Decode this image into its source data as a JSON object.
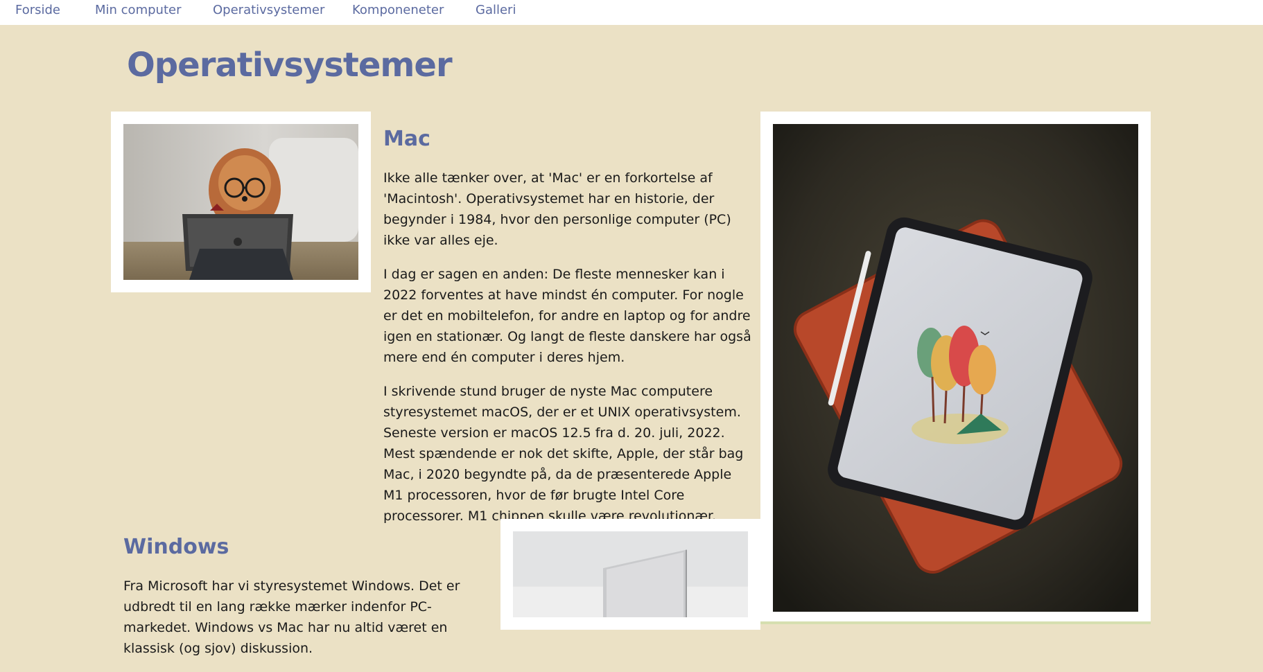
{
  "nav": {
    "items": [
      {
        "label": "Forside"
      },
      {
        "label": "Min computer"
      },
      {
        "label": "Operativsystemer"
      },
      {
        "label": "Komponeneter"
      },
      {
        "label": "Galleri"
      }
    ]
  },
  "page": {
    "title": "Operativsystemer"
  },
  "mac": {
    "heading": "Mac",
    "paragraphs": [
      "Ikke alle tænker over, at 'Mac' er en forkortelse af 'Macintosh'. Operativsystemet har en historie, der begynder i 1984, hvor den personlige computer (PC) ikke var alles eje.",
      "I dag er sagen en anden: De fleste mennesker kan i 2022 forventes at have mindst én computer. For nogle er det en mobiltelefon, for andre en laptop og for andre igen en stationær. Og langt de fleste danskere har også mere end én computer i deres hjem.",
      "I skrivende stund bruger de nyste Mac computere styresystemet macOS, der er et UNIX operativsystem. Seneste version er macOS 12.5 fra d. 20. juli, 2022. Mest spændende er nok det skifte, Apple, der står bag Mac, i 2020 begyndte på, da de præsenterede Apple M1 processoren, hvor de før brugte Intel Core processorer. M1 chippen skulle være revolutionær."
    ]
  },
  "windows": {
    "heading": "Windows",
    "paragraphs": [
      "Fra Microsoft har vi styresystemet Windows. Det er udbredt til en lang række mærker indenfor PC-markedet. Windows vs Mac har nu altid været en klassisk (og sjov) diskussion."
    ]
  },
  "colors": {
    "background": "#ebe1c5",
    "accent": "#5b6aa0",
    "text": "#1a1a1a",
    "frame": "#ffffff"
  }
}
